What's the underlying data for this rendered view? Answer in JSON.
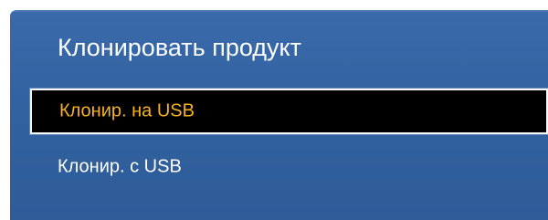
{
  "dialog": {
    "title": "Клонировать продукт",
    "items": [
      {
        "label": "Клонир. на USB",
        "selected": true
      },
      {
        "label": "Клонир. с USB",
        "selected": false
      }
    ]
  },
  "colors": {
    "panel_background": "#3366a6",
    "selected_text": "#f5b21b",
    "selected_background": "#000000",
    "text": "#ffffff"
  }
}
